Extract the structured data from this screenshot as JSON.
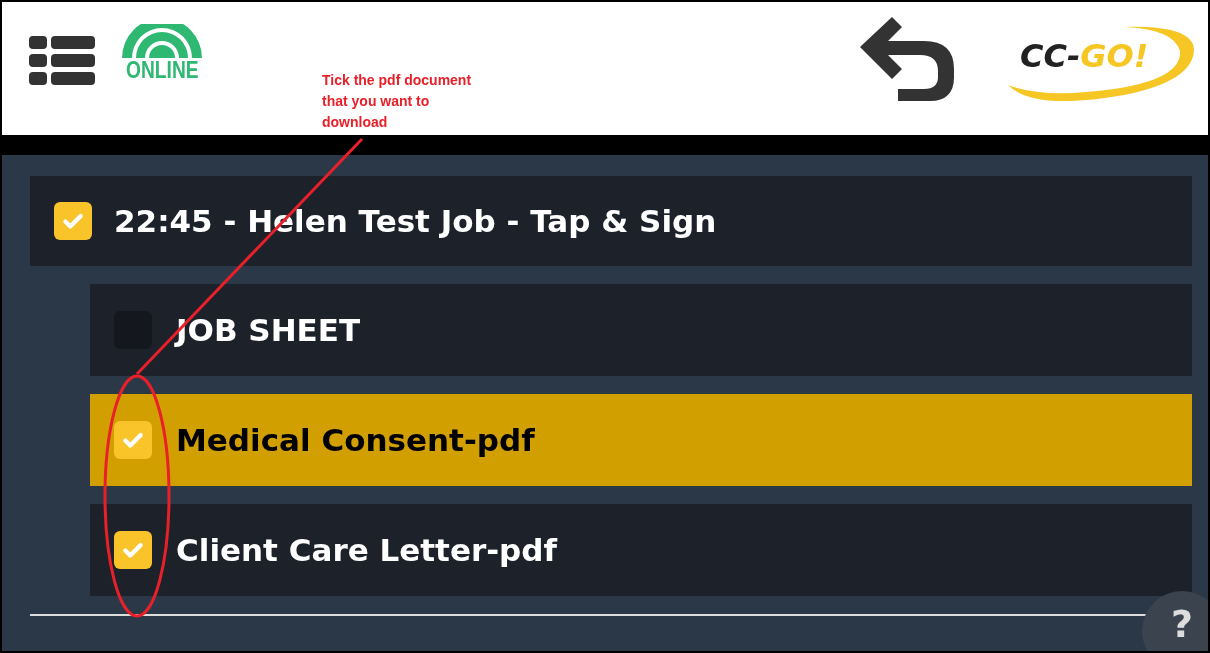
{
  "header": {
    "status": "ONLINE",
    "logo": {
      "part_1": "CC-",
      "part_2": "GO!"
    }
  },
  "annotation": {
    "text": "Tick the pdf document that you want to download"
  },
  "job": {
    "title": "22:45 - Helen Test Job - Tap & Sign",
    "checked": true
  },
  "documents": [
    {
      "name": "JOB SHEET",
      "checked": false,
      "selected": false
    },
    {
      "name": "Medical Consent-pdf",
      "checked": true,
      "selected": true
    },
    {
      "name": "Client Care Letter-pdf",
      "checked": true,
      "selected": false
    }
  ],
  "help": {
    "label": "?"
  }
}
